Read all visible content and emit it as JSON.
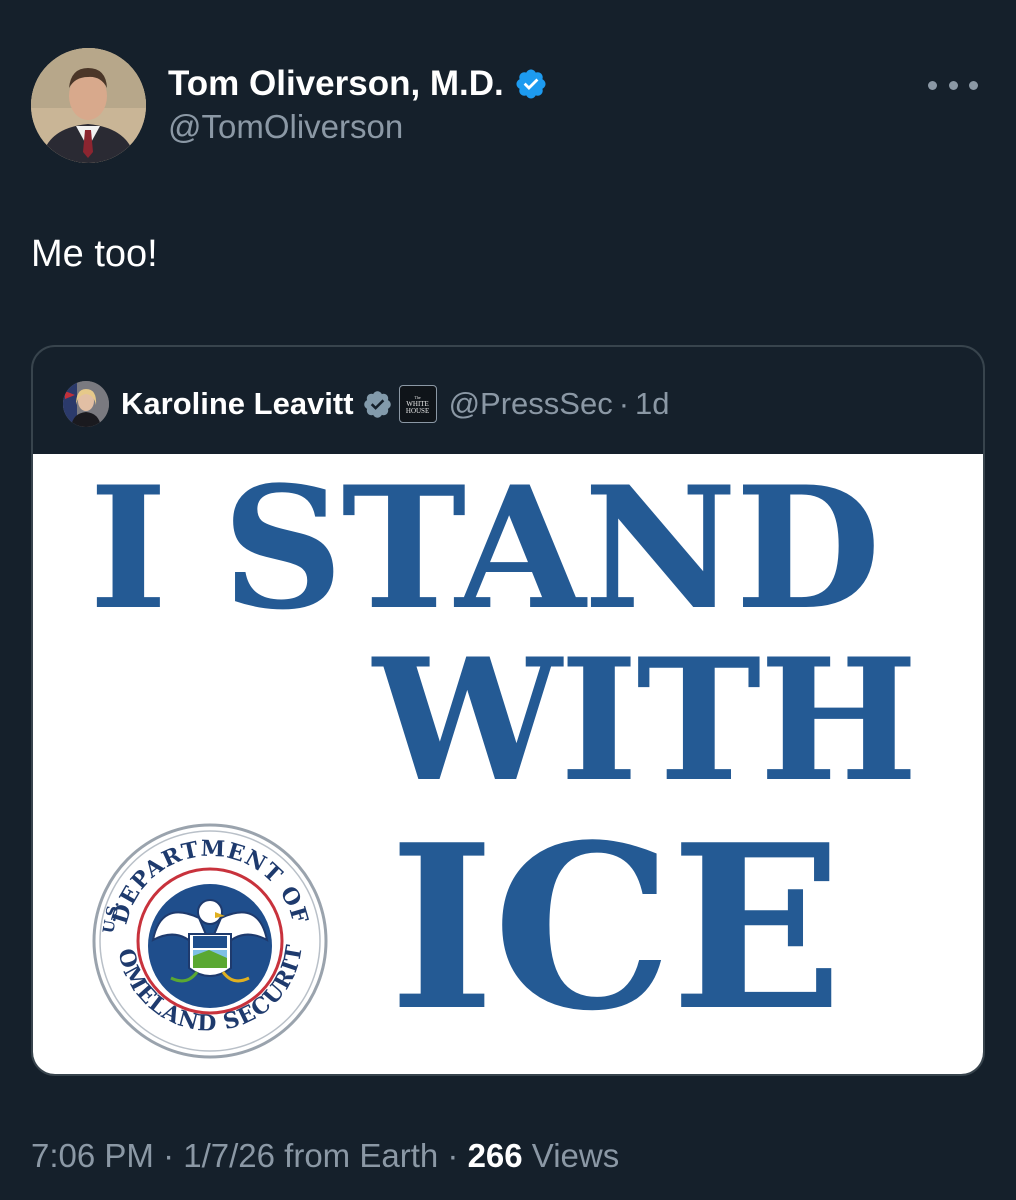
{
  "tweet": {
    "author": {
      "display_name": "Tom Oliverson, M.D.",
      "handle": "@TomOliverson",
      "verified": true
    },
    "text": "Me too!",
    "quoted": {
      "author": {
        "display_name": "Karoline Leavitt",
        "handle": "@PressSec",
        "verified": true,
        "affiliation_badge": {
          "the": "The",
          "line1": "WHITE",
          "line2": "HOUSE"
        }
      },
      "separator": "·",
      "time": "1d",
      "image": {
        "headline_line1": "I STAND",
        "headline_line2": "WITH",
        "headline_line3": "ICE",
        "seal": {
          "top_text": "DEPARTMENT OF",
          "left_text": "U.S.",
          "bottom_text": "HOMELAND SECURITY"
        }
      }
    },
    "footer": {
      "time": "7:06 PM",
      "separator": "·",
      "date": "1/7/26 from Earth",
      "views_count": "266",
      "views_label": "Views"
    }
  },
  "icons": {
    "verified": "verified-badge-icon",
    "more": "more-options-icon"
  },
  "colors": {
    "background": "#15202b",
    "text_primary": "#ffffff",
    "text_secondary": "#8b98a5",
    "border": "#38444d",
    "verified_blue": "#1d9bf0",
    "verified_gray": "#829aab",
    "headline_blue": "#245a94"
  }
}
